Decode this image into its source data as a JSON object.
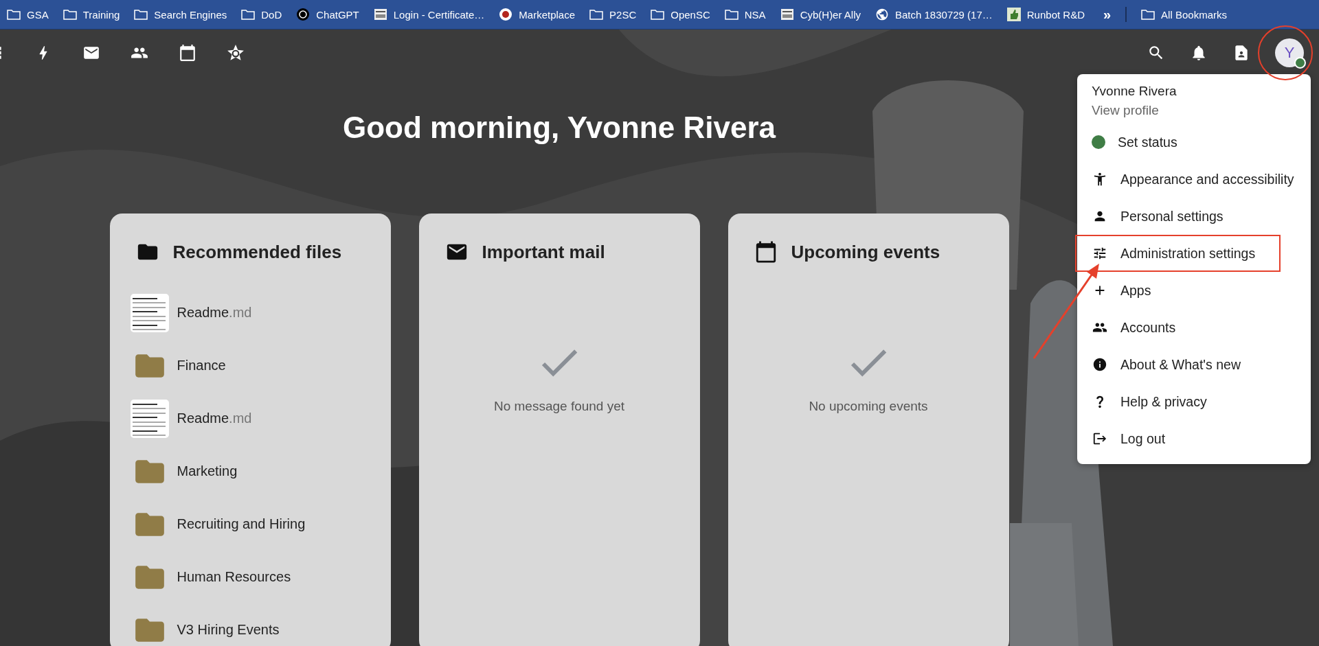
{
  "bookmarks": [
    {
      "label": "GSA",
      "kind": "folder"
    },
    {
      "label": "Training",
      "kind": "folder"
    },
    {
      "label": "Search Engines",
      "kind": "folder"
    },
    {
      "label": "DoD",
      "kind": "folder"
    },
    {
      "label": "ChatGPT",
      "kind": "site"
    },
    {
      "label": "Login - Certificate…",
      "kind": "site"
    },
    {
      "label": "Marketplace",
      "kind": "site"
    },
    {
      "label": "P2SC",
      "kind": "folder"
    },
    {
      "label": "OpenSC",
      "kind": "folder"
    },
    {
      "label": "NSA",
      "kind": "folder"
    },
    {
      "label": "Cyb(H)er Ally",
      "kind": "site"
    },
    {
      "label": "Batch 1830729 (17…",
      "kind": "site"
    },
    {
      "label": "Runbot R&D",
      "kind": "site"
    }
  ],
  "bookmarks_more": "»",
  "all_bookmarks": "All Bookmarks",
  "user": {
    "initial": "Y",
    "color": "#3f7d45"
  },
  "greeting": "Good morning, Yvonne Rivera",
  "cards": [
    {
      "kind": "files",
      "title": "Recommended files",
      "files": [
        {
          "name": "Readme",
          "ext": ".md",
          "kind": "document"
        },
        {
          "name": "Finance",
          "kind": "folder"
        },
        {
          "name": "Readme",
          "ext": ".md",
          "kind": "document"
        },
        {
          "name": "Marketing",
          "kind": "folder"
        },
        {
          "name": "Recruiting and Hiring",
          "kind": "folder"
        },
        {
          "name": "Human Resources",
          "kind": "folder"
        },
        {
          "name": "V3 Hiring Events",
          "kind": "folder"
        }
      ]
    },
    {
      "kind": "empty",
      "title": "Important mail",
      "empty_text": "No message found yet"
    },
    {
      "kind": "empty",
      "title": "Upcoming events",
      "empty_text": "No upcoming events"
    }
  ],
  "menu": {
    "name": "Yvonne Rivera",
    "profile_link": "View profile",
    "items": [
      {
        "label": "Set status",
        "kind": "status",
        "color": "#3f7d45",
        "highlighted": false
      },
      {
        "label": "Appearance and accessibility",
        "kind": "link",
        "highlighted": false
      },
      {
        "label": "Personal settings",
        "kind": "link",
        "highlighted": false
      },
      {
        "label": "Administration settings",
        "kind": "link",
        "highlighted": true
      },
      {
        "label": "Apps",
        "kind": "link",
        "highlighted": false
      },
      {
        "label": "Accounts",
        "kind": "link",
        "highlighted": false
      },
      {
        "label": "About & What's new",
        "kind": "link",
        "highlighted": false
      },
      {
        "label": "Help & privacy",
        "kind": "link",
        "highlighted": false
      },
      {
        "label": "Log out",
        "kind": "link",
        "highlighted": false
      }
    ]
  }
}
